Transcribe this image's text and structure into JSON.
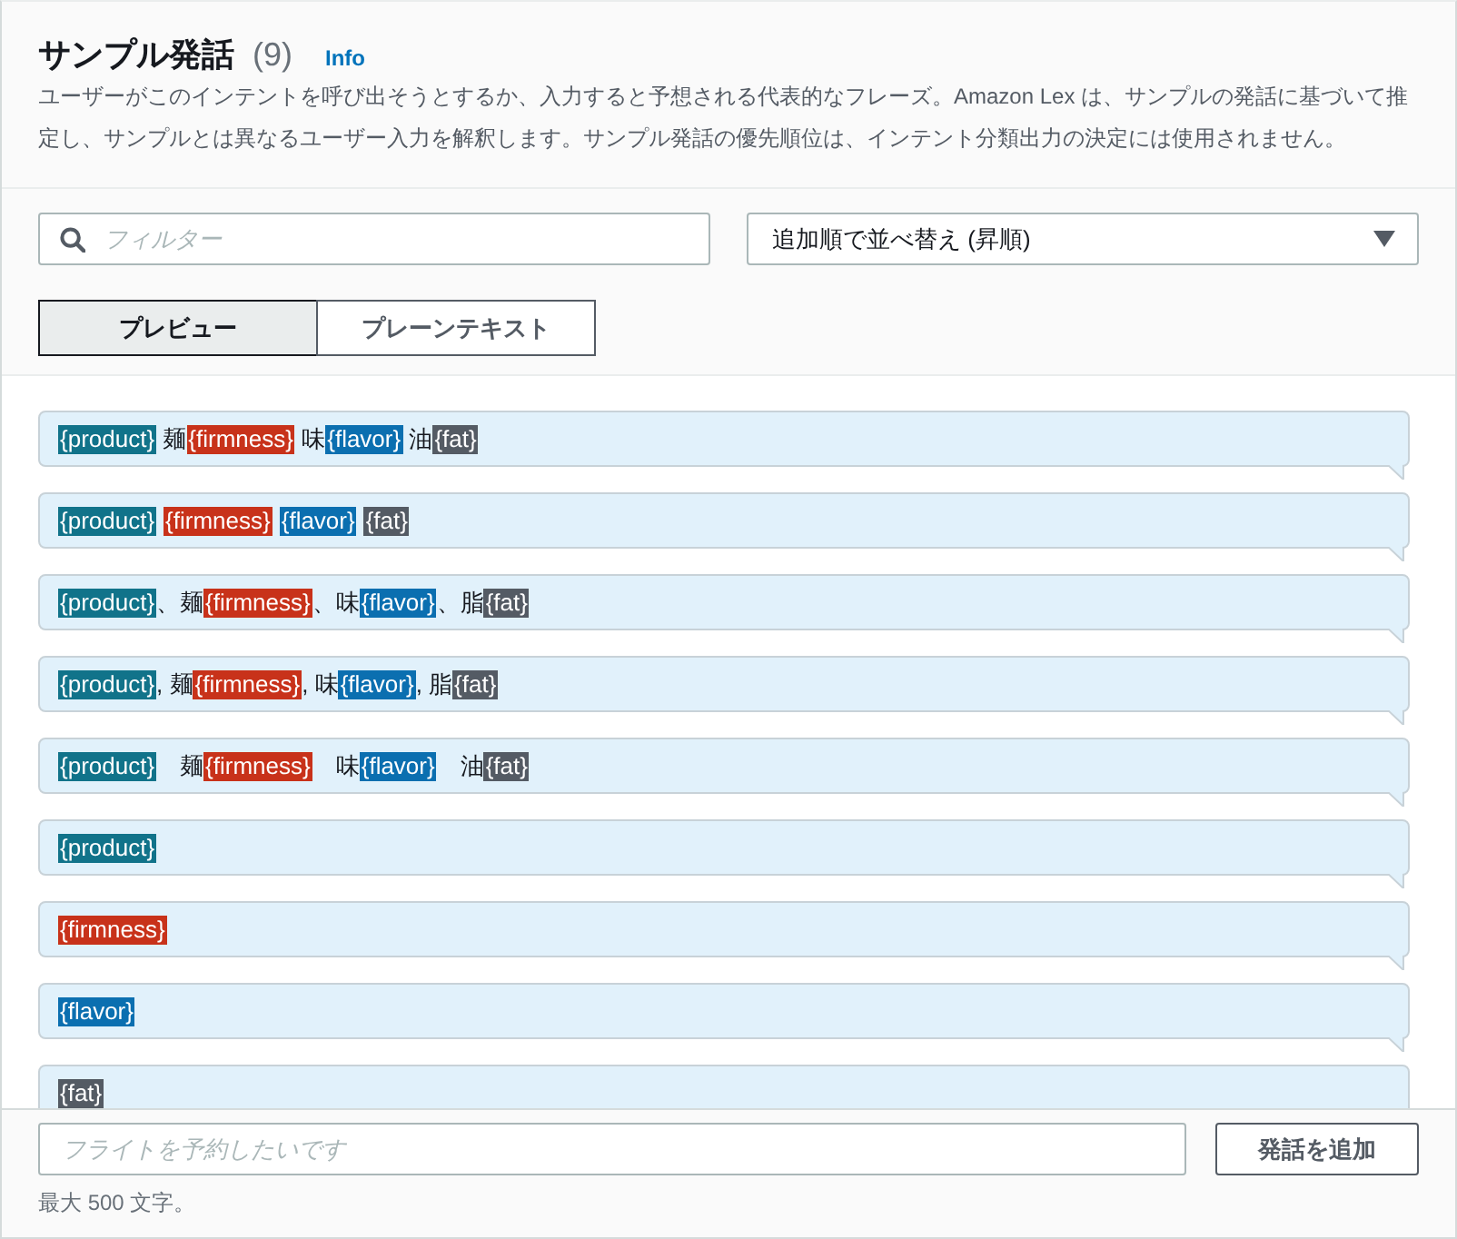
{
  "header": {
    "title": "サンプル発話",
    "count": "(9)",
    "info_link": "Info",
    "description": "ユーザーがこのインテントを呼び出そうとするか、入力すると予想される代表的なフレーズ。Amazon Lex は、サンプルの発話に基づいて推定し、サンプルとは異なるユーザー入力を解釈します。サンプル発話の優先順位は、インテント分類出力の決定には使用されません。"
  },
  "filter": {
    "placeholder": "フィルター"
  },
  "sort": {
    "value": "追加順で並べ替え (昇順)"
  },
  "view_tabs": [
    {
      "label": "プレビュー",
      "selected": true
    },
    {
      "label": "プレーンテキスト",
      "selected": false
    }
  ],
  "utterances": [
    {
      "segments": [
        {
          "kind": "slot",
          "text": "{product}",
          "color": "#11738a"
        },
        {
          "kind": "text",
          "text": " 麺"
        },
        {
          "kind": "slot",
          "text": "{firmness}",
          "color": "#c8321a"
        },
        {
          "kind": "text",
          "text": " 味"
        },
        {
          "kind": "slot",
          "text": "{flavor}",
          "color": "#0b6fb0"
        },
        {
          "kind": "text",
          "text": " 油"
        },
        {
          "kind": "slot",
          "text": "{fat}",
          "color": "#545b64"
        }
      ]
    },
    {
      "segments": [
        {
          "kind": "slot",
          "text": "{product}",
          "color": "#11738a"
        },
        {
          "kind": "slot",
          "text": "{firmness}",
          "color": "#c8321a"
        },
        {
          "kind": "slot",
          "text": "{flavor}",
          "color": "#0b6fb0"
        },
        {
          "kind": "slot",
          "text": "{fat}",
          "color": "#545b64"
        }
      ]
    },
    {
      "segments": [
        {
          "kind": "slot",
          "text": "{product}",
          "color": "#11738a"
        },
        {
          "kind": "text",
          "text": "、麺"
        },
        {
          "kind": "slot",
          "text": "{firmness}",
          "color": "#c8321a"
        },
        {
          "kind": "text",
          "text": "、味"
        },
        {
          "kind": "slot",
          "text": "{flavor}",
          "color": "#0b6fb0"
        },
        {
          "kind": "text",
          "text": "、脂"
        },
        {
          "kind": "slot",
          "text": "{fat}",
          "color": "#545b64"
        }
      ]
    },
    {
      "segments": [
        {
          "kind": "slot",
          "text": "{product}",
          "color": "#11738a"
        },
        {
          "kind": "text",
          "text": ", 麺"
        },
        {
          "kind": "slot",
          "text": "{firmness}",
          "color": "#c8321a"
        },
        {
          "kind": "text",
          "text": ", 味"
        },
        {
          "kind": "slot",
          "text": "{flavor}",
          "color": "#0b6fb0"
        },
        {
          "kind": "text",
          "text": ", 脂"
        },
        {
          "kind": "slot",
          "text": "{fat}",
          "color": "#545b64"
        }
      ]
    },
    {
      "segments": [
        {
          "kind": "slot",
          "text": "{product}",
          "color": "#11738a"
        },
        {
          "kind": "text",
          "text": "　麺"
        },
        {
          "kind": "slot",
          "text": "{firmness}",
          "color": "#c8321a"
        },
        {
          "kind": "text",
          "text": "　味"
        },
        {
          "kind": "slot",
          "text": "{flavor}",
          "color": "#0b6fb0"
        },
        {
          "kind": "text",
          "text": "　油"
        },
        {
          "kind": "slot",
          "text": "{fat}",
          "color": "#545b64"
        }
      ]
    },
    {
      "segments": [
        {
          "kind": "slot",
          "text": "{product}",
          "color": "#11738a"
        }
      ]
    },
    {
      "segments": [
        {
          "kind": "slot",
          "text": "{firmness}",
          "color": "#c8321a"
        }
      ]
    },
    {
      "segments": [
        {
          "kind": "slot",
          "text": "{flavor}",
          "color": "#0b6fb0"
        }
      ]
    },
    {
      "segments": [
        {
          "kind": "slot",
          "text": "{fat}",
          "color": "#545b64"
        }
      ]
    }
  ],
  "new_utterance": {
    "placeholder": "フライトを予約したいです",
    "button": "発話を追加",
    "hint": "最大 500 文字。"
  }
}
